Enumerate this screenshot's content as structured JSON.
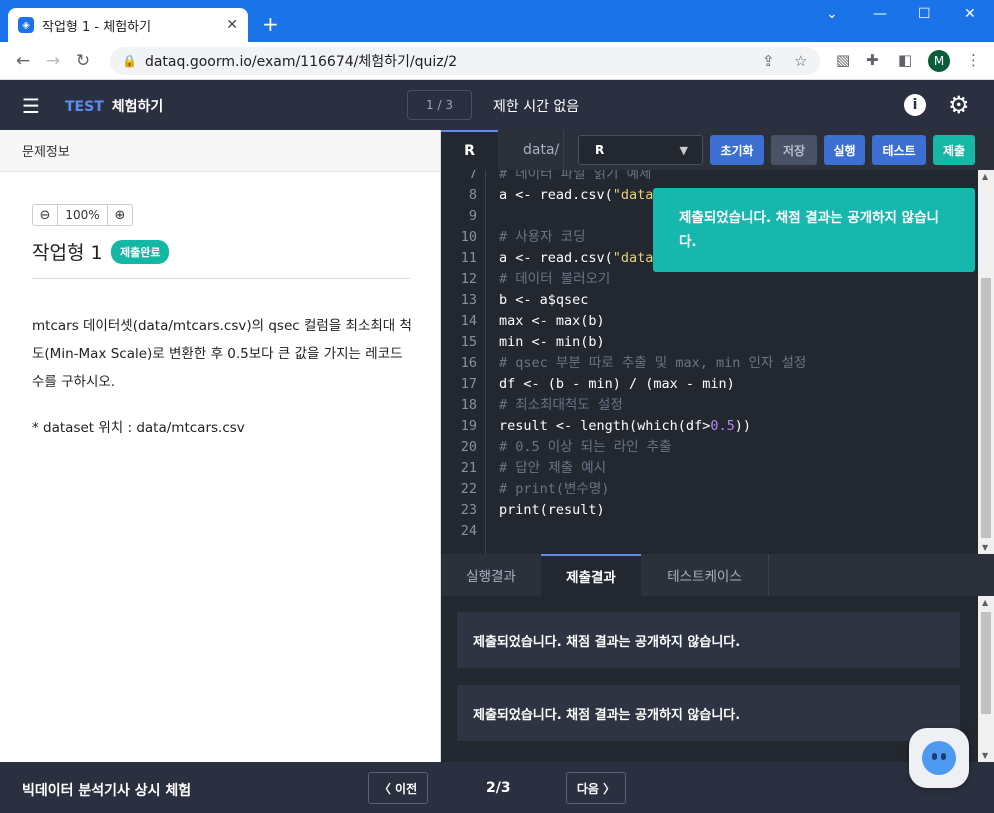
{
  "browser": {
    "tab_title": "작업형 1 - 체험하기",
    "url": "dataq.goorm.io/exam/116674/체험하기/quiz/2",
    "profile_initial": "M"
  },
  "header": {
    "brand_test": "TEST",
    "brand_title": "체험하기",
    "pager": "1 / 3",
    "timer": "제한 시간 없음"
  },
  "problem": {
    "panel_title": "문제정보",
    "zoom": "100%",
    "title": "작업형 1",
    "badge": "제출완료",
    "body": "mtcars 데이터셋(data/mtcars.csv)의 qsec 컬럼을 최소최대 척도(Min-Max Scale)로 변환한 후 0.5보다 큰 값을 가지는 레코드 수를 구하시오.",
    "note": "* dataset 위치 : data/mtcars.csv"
  },
  "editor": {
    "tab_lang": "R",
    "tab_file": "data/",
    "language_select": "R",
    "buttons": {
      "reset": "초기화",
      "save": "저장",
      "run": "실행",
      "test": "테스트",
      "submit": "제출"
    },
    "lines": [
      {
        "n": "7",
        "text": "# 데이터 파일 읽기 예제"
      },
      {
        "n": "8",
        "text": "a <- read.csv(\"data"
      },
      {
        "n": "9",
        "text": ""
      },
      {
        "n": "10",
        "text": "# 사용자 코딩"
      },
      {
        "n": "11",
        "text": "a <- read.csv(\"data"
      },
      {
        "n": "12",
        "text": "# 데이터 불러오기"
      },
      {
        "n": "13",
        "text": "b <- a$qsec"
      },
      {
        "n": "14",
        "text": "max <- max(b)"
      },
      {
        "n": "15",
        "text": "min <- min(b)"
      },
      {
        "n": "16",
        "text": "# qsec 부분 따로 추출 및 max, min 인자 설정"
      },
      {
        "n": "17",
        "text": "df <- (b - min) / (max - min)"
      },
      {
        "n": "18",
        "text": "# 최소최대척도 설정"
      },
      {
        "n": "19",
        "text": "result <- length(which(df>0.5))"
      },
      {
        "n": "20",
        "text": "# 0.5 이상 되는 라인 추출"
      },
      {
        "n": "21",
        "text": "# 답안 제출 예시"
      },
      {
        "n": "22",
        "text": "# print(변수명)"
      },
      {
        "n": "23",
        "text": "print(result)"
      },
      {
        "n": "24",
        "text": ""
      }
    ]
  },
  "toast": "제출되었습니다. 채점 결과는 공개하지 않습니다.",
  "results": {
    "tabs": [
      "실행결과",
      "제출결과",
      "테스트케이스"
    ],
    "messages": [
      "제출되었습니다. 채점 결과는 공개하지 않습니다.",
      "제출되었습니다. 채점 결과는 공개하지 않습니다."
    ]
  },
  "footer": {
    "title": "빅데이터 분석기사 상시 체험",
    "prev": "〈 이전",
    "count": "2/3",
    "next": "다음 〉"
  }
}
